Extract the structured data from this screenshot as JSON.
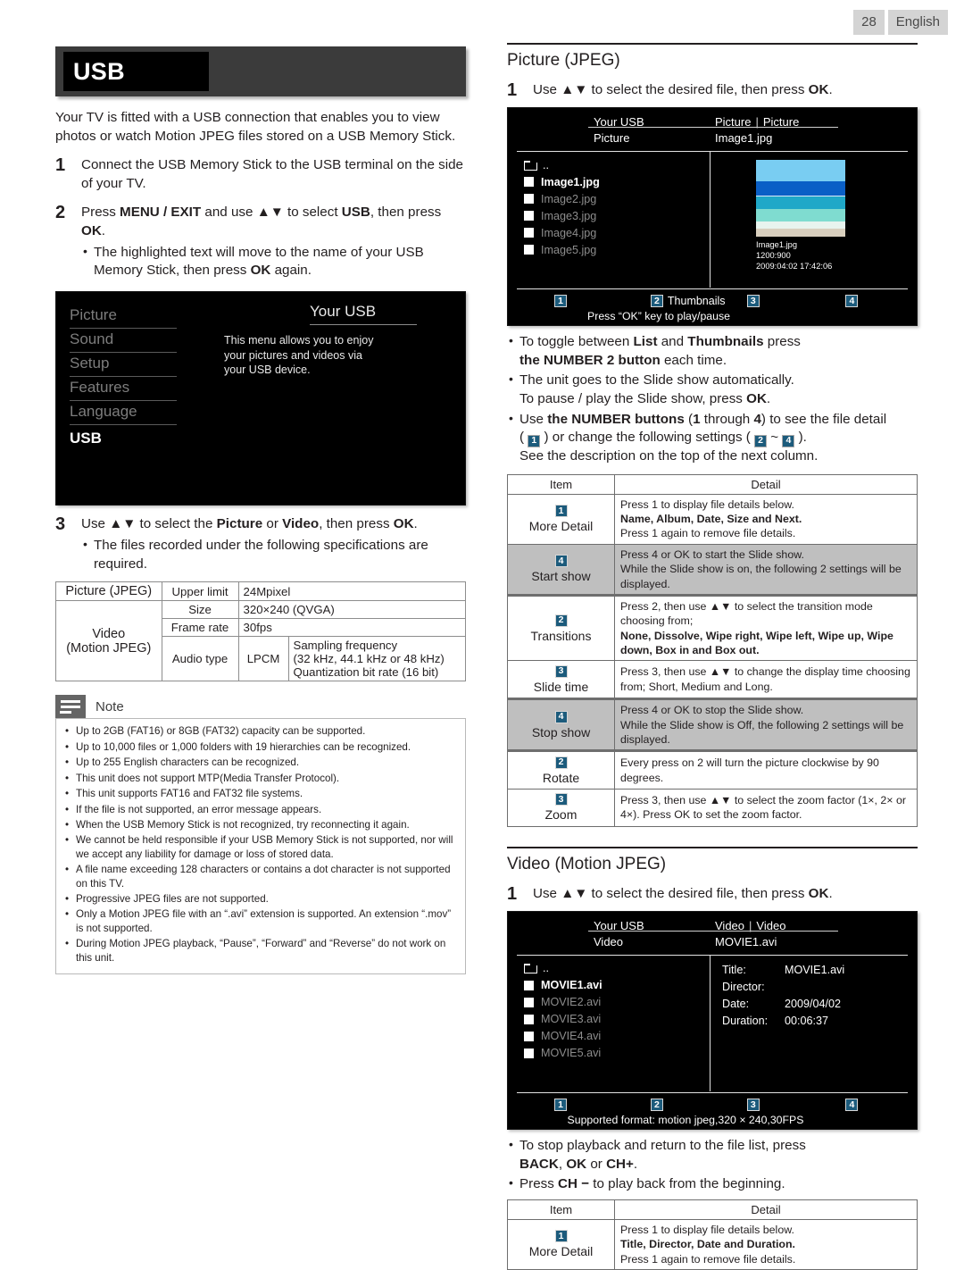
{
  "page": {
    "number": "28",
    "language": "English"
  },
  "left": {
    "banner_title": "USB",
    "intro": "Your TV is fitted with a USB connection that enables you to view photos or watch Motion JPEG files stored on a USB Memory Stick.",
    "steps": [
      {
        "num": "1",
        "text": "Connect the USB Memory Stick to the USB terminal on the side of your TV."
      },
      {
        "num": "2",
        "text": "Press MENU / EXIT and use ▲▼ to select USB, then press OK.",
        "bullets": [
          "The highlighted text will move to the name of your USB Memory Stick, then press OK again."
        ]
      },
      {
        "num": "3",
        "text": "Use ▲▼ to select the Picture or Video, then press OK.",
        "bullets": [
          "The files recorded under the following specifications are required."
        ]
      }
    ],
    "tv_menu": {
      "items": [
        "Picture",
        "Sound",
        "Setup",
        "Features",
        "Language"
      ],
      "active_item": "USB",
      "description": "This menu allows you to enjoy your pictures and videos via your USB device.",
      "right_label": "Your USB"
    },
    "spec_table": {
      "rows": [
        {
          "cat": "Picture (JPEG)",
          "key": "Upper limit",
          "value": "24Mpixel"
        },
        {
          "cat": "Video (Motion JPEG)",
          "key": "Size",
          "value": "320×240 (QVGA)"
        },
        {
          "key": "Frame rate",
          "value": "30fps"
        },
        {
          "key": "Audio type",
          "codec": "LPCM",
          "value": "Sampling frequency (32 kHz, 44.1 kHz or 48 kHz) Quantization bit rate (16 bit)",
          "lines": [
            "Sampling frequency",
            "(32 kHz, 44.1 kHz or 48 kHz)",
            "Quantization bit rate (16 bit)"
          ]
        }
      ]
    },
    "note": {
      "title": "Note",
      "items": [
        "Up to 2GB (FAT16) or 8GB (FAT32) capacity can be supported.",
        "Up to 10,000 files or 1,000 folders with 19 hierarchies can be recognized.",
        "Up to 255 English characters can be recognized.",
        "This unit does not support MTP(Media Transfer Protocol).",
        "This unit supports FAT16 and FAT32 file systems.",
        "If the file is not supported, an error message appears.",
        "When the USB Memory Stick is not recognized, try reconnecting it again.",
        "We cannot be held responsible if your USB Memory Stick is not supported, nor will we accept any liability for damage or loss of stored data.",
        "A file name exceeding 128 characters or contains a dot character is not supported on this TV.",
        "Progressive JPEG files are not supported.",
        "Only a Motion JPEG file with an “.avi” extension is supported. An extension “.mov” is not supported.",
        "During Motion JPEG playback, “Pause”, “Forward” and “Reverse” do not work on this unit."
      ]
    }
  },
  "right": {
    "picture_section": {
      "heading": "Picture (JPEG)",
      "step_num": "1",
      "step_text": "Use ▲▼ to select the desired file, then press OK.",
      "screen": {
        "usb_label": "Your USB",
        "crumb_a": "Picture",
        "crumb_b": "Picture",
        "folder": "Picture",
        "current_file": "Image1.jpg",
        "parent_entry": "..",
        "files": [
          "Image1.jpg",
          "Image2.jpg",
          "Image3.jpg",
          "Image4.jpg",
          "Image5.jpg"
        ],
        "preview_name": "Image1.jpg",
        "preview_size": "1200:900",
        "preview_date": "2009:04:02 17:42:06",
        "keys": [
          {
            "num": "1",
            "label": ""
          },
          {
            "num": "2",
            "label": "Thumbnails"
          },
          {
            "num": "3",
            "label": ""
          },
          {
            "num": "4",
            "label": ""
          }
        ],
        "hint": "Press “OK” key to play/pause"
      },
      "bullets": [
        "To toggle between List and Thumbnails press the NUMBER 2 button each time.",
        "The unit goes to the Slide show automatically. To pause / play the Slide show, press OK.",
        "Use the NUMBER buttons (1 through 4) to see the file detail ( 1 ) or change the following settings ( 2 ~ 4 ). See the description on the top of the next column."
      ]
    },
    "picture_table": {
      "header_item": "Item",
      "header_detail": "Detail",
      "rows": [
        {
          "key": "1",
          "label": "More Detail",
          "shaded": false,
          "detail_lines": [
            "Press 1 to display file details below.",
            "Name, Album, Date, Size and Next.",
            "Press 1 again to remove file details."
          ]
        },
        {
          "key": "4",
          "label": "Start show",
          "shaded": true,
          "detail_lines": [
            "Press 4 or OK to start the Slide show.",
            "While the Slide show is on, the following 2 settings will be displayed."
          ]
        },
        {
          "key": "2",
          "label": "Transitions",
          "shaded": false,
          "thicktop": true,
          "detail_lines": [
            "Press 2, then use ▲▼ to select the transition mode choosing from;",
            "None, Dissolve, Wipe right, Wipe left, Wipe up, Wipe down, Box in and Box out."
          ]
        },
        {
          "key": "3",
          "label": "Slide time",
          "shaded": false,
          "detail_lines": [
            "Press 3, then use ▲▼ to change the display time choosing from; Short, Medium and Long."
          ]
        },
        {
          "key": "4",
          "label": "Stop show",
          "shaded": true,
          "thicktop": true,
          "detail_lines": [
            "Press 4 or OK to stop the Slide show.",
            "While the Slide show is Off, the following 2 settings will be displayed."
          ]
        },
        {
          "key": "2",
          "label": "Rotate",
          "shaded": false,
          "thicktop": true,
          "detail_lines": [
            "Every press on 2 will turn the picture clockwise by 90 degrees."
          ]
        },
        {
          "key": "3",
          "label": "Zoom",
          "shaded": false,
          "detail_lines": [
            "Press 3, then use ▲▼ to select the zoom factor (1×, 2× or 4×). Press OK to set the zoom factor."
          ]
        }
      ]
    },
    "video_section": {
      "heading": "Video (Motion JPEG)",
      "step_num": "1",
      "step_text": "Use ▲▼ to select the desired file, then press OK.",
      "screen": {
        "usb_label": "Your USB",
        "crumb_a": "Video",
        "crumb_b": "Video",
        "folder": "Video",
        "current_file": "MOVIE1.avi",
        "parent_entry": "..",
        "files": [
          "MOVIE1.avi",
          "MOVIE2.avi",
          "MOVIE3.avi",
          "MOVIE4.avi",
          "MOVIE5.avi"
        ],
        "meta": [
          {
            "key": "Title:",
            "value": "MOVIE1.avi"
          },
          {
            "key": "Director:",
            "value": ""
          },
          {
            "key": "Date:",
            "value": "2009/04/02"
          },
          {
            "key": "Duration:",
            "value": "00:06:37"
          }
        ],
        "keys": [
          {
            "num": "1",
            "label": ""
          },
          {
            "num": "2",
            "label": ""
          },
          {
            "num": "3",
            "label": ""
          },
          {
            "num": "4",
            "label": ""
          }
        ],
        "hint": "Supported format: motion jpeg,320 × 240,30FPS"
      },
      "bullets": [
        "To stop playback and return to the file list, press BACK, OK or CH+.",
        "Press CH − to play back from the beginning."
      ]
    },
    "video_table": {
      "header_item": "Item",
      "header_detail": "Detail",
      "rows": [
        {
          "key": "1",
          "label": "More Detail",
          "detail_lines": [
            "Press 1 to display file details below.",
            "Title, Director, Date and Duration.",
            "Press 1 again to remove file details."
          ]
        }
      ]
    }
  }
}
